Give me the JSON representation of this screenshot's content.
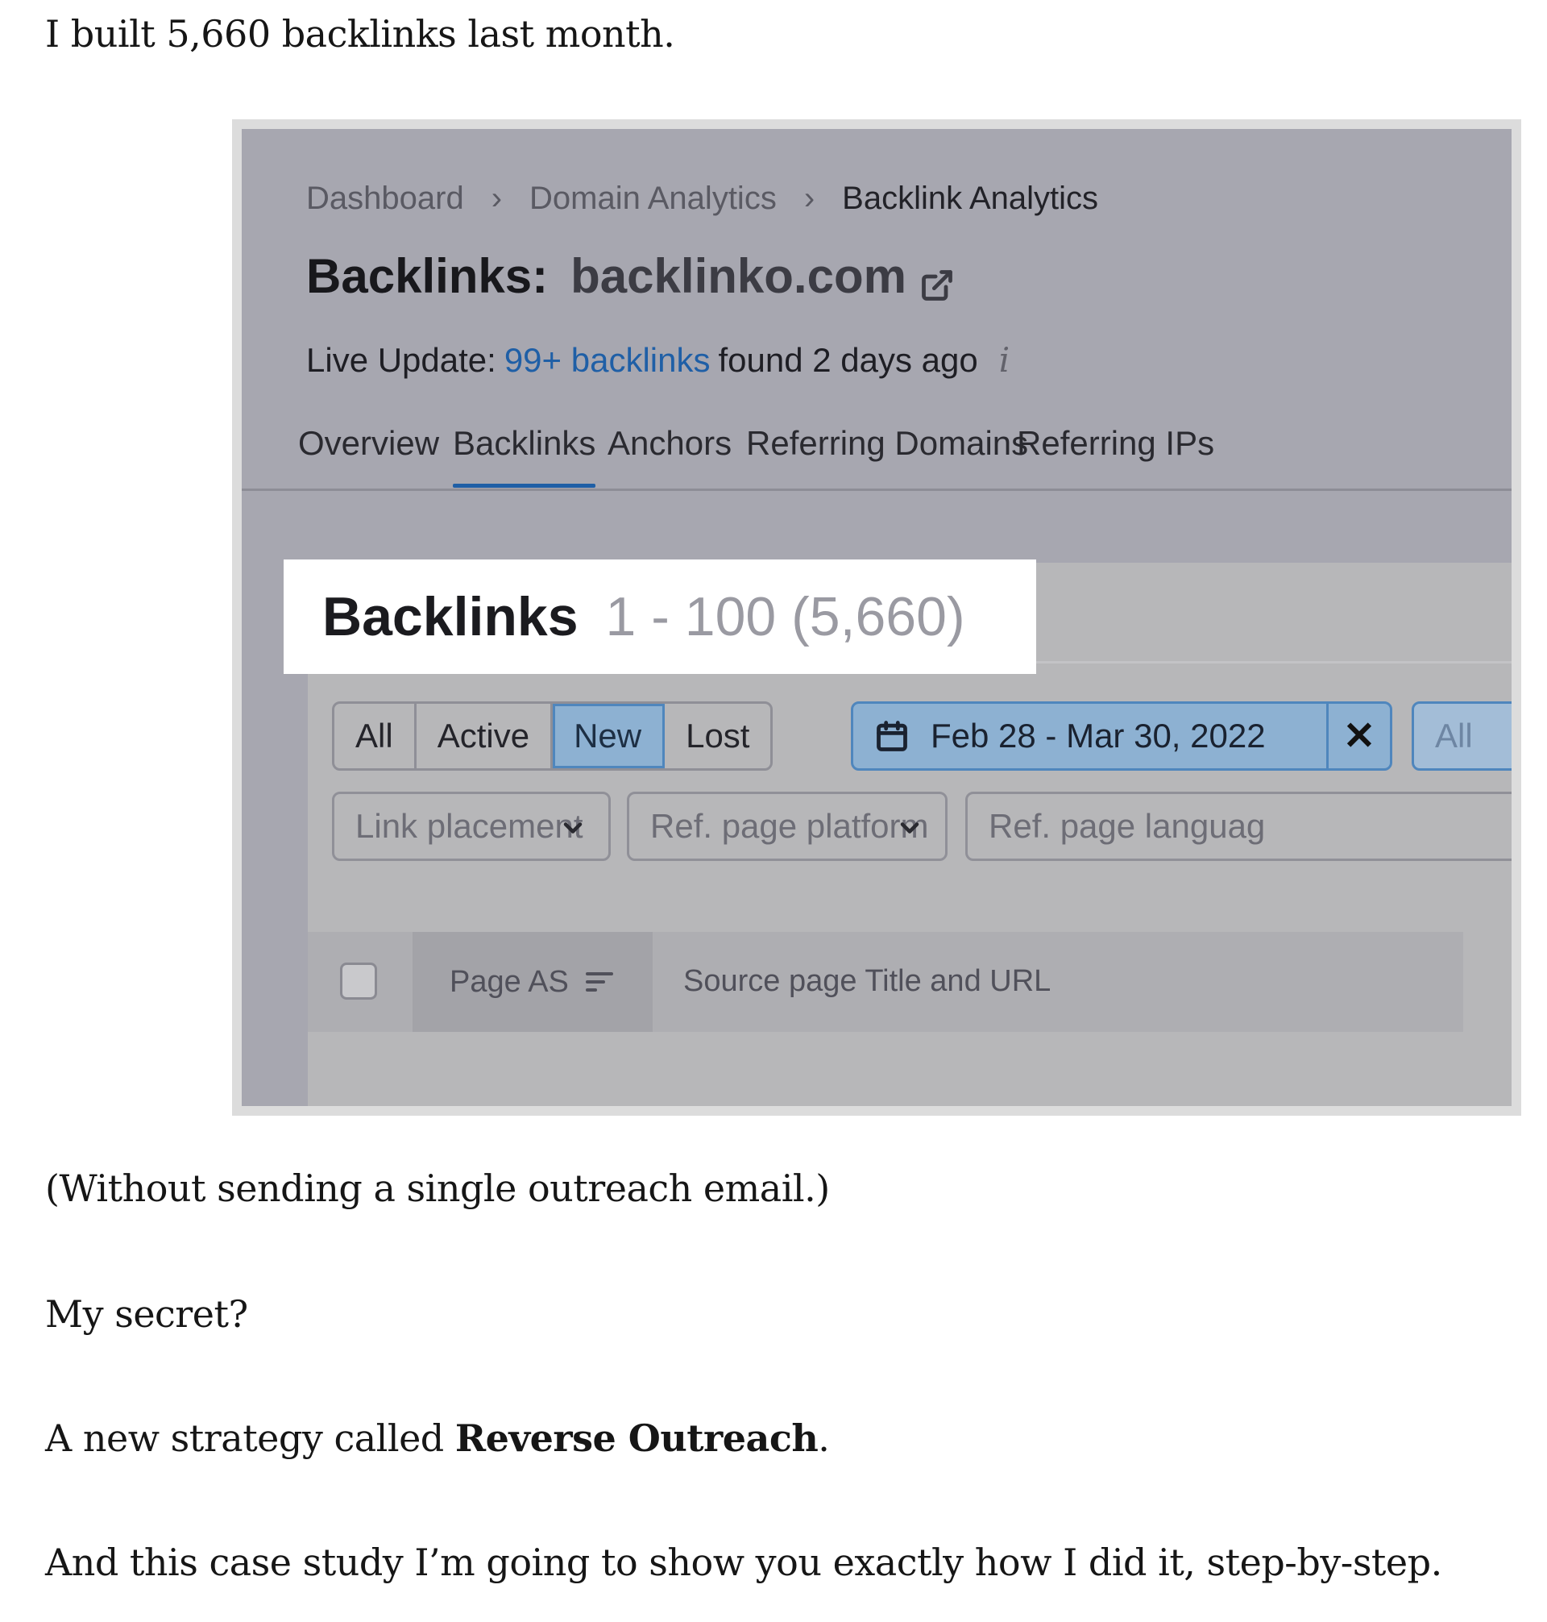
{
  "article": {
    "intro": "I built 5,660 backlinks last month.",
    "p1": "(Without sending a single outreach email.)",
    "p2": "My secret?",
    "p3_prefix": "A new strategy called ",
    "p3_bold": "Reverse Outreach",
    "p3_suffix": ".",
    "p4": "And this case study I’m going to show you exactly how I did it, step-by-step."
  },
  "screenshot": {
    "breadcrumb": [
      "Dashboard",
      "Domain Analytics",
      "Backlink Analytics"
    ],
    "title_label": "Backlinks:",
    "title_domain": "backlinko.com",
    "live_update": {
      "prefix": "Live Update:",
      "link": "99+ backlinks",
      "suffix": "found 2 days ago",
      "info_icon": "info-icon"
    },
    "tabs": [
      "Overview",
      "Backlinks",
      "Anchors",
      "Referring Domains",
      "Referring IPs"
    ],
    "active_tab": "Backlinks",
    "summary": {
      "label": "Backlinks",
      "range": "1 - 100 (5,660)"
    },
    "status_filter": {
      "options": [
        "All",
        "Active",
        "New",
        "Lost"
      ],
      "selected": "New"
    },
    "date_filter": {
      "value": "Feb 28 - Mar 30, 2022",
      "clear": "✕",
      "next_button": "All"
    },
    "dropdowns": [
      "Link placement",
      "Ref. page platform",
      "Ref. page languag"
    ],
    "table_headers": {
      "page_as": "Page AS",
      "source": "Source page Title and URL"
    },
    "colors": {
      "overlay": "#a7a7b0",
      "link": "#1f5fa6",
      "selected_fill": "#8db1d2",
      "selected_border": "#4f86bd"
    }
  }
}
